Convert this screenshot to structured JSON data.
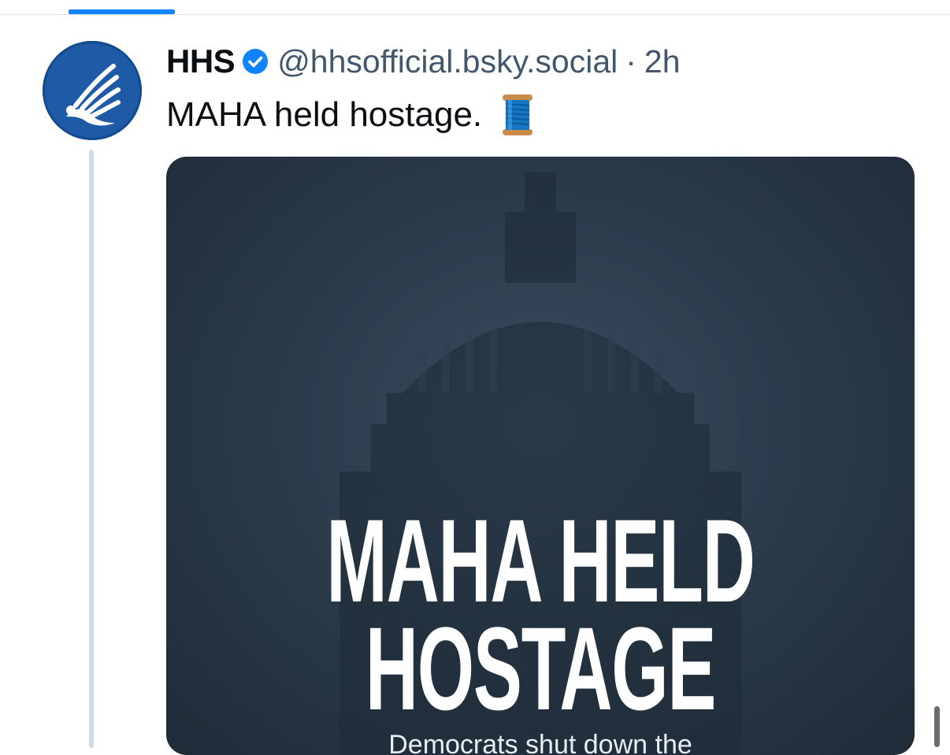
{
  "post": {
    "author_name": "HHS",
    "handle": "@hhsofficial.bsky.social",
    "separator": "·",
    "time_ago": "2h",
    "text": "MAHA held hostage.",
    "emoji_icon": "spool-of-thread-icon",
    "verified_icon": "verified-badge-icon"
  },
  "media": {
    "headline_line1": "MAHA HELD",
    "headline_line2": "HOSTAGE",
    "subhead": "Democrats shut down the"
  },
  "colors": {
    "accent": "#1083fe",
    "avatar_bg": "#1f5aa6",
    "handle": "#42576c",
    "thread_line": "#d4d9e6",
    "media_bg": "#2c3c4b"
  }
}
